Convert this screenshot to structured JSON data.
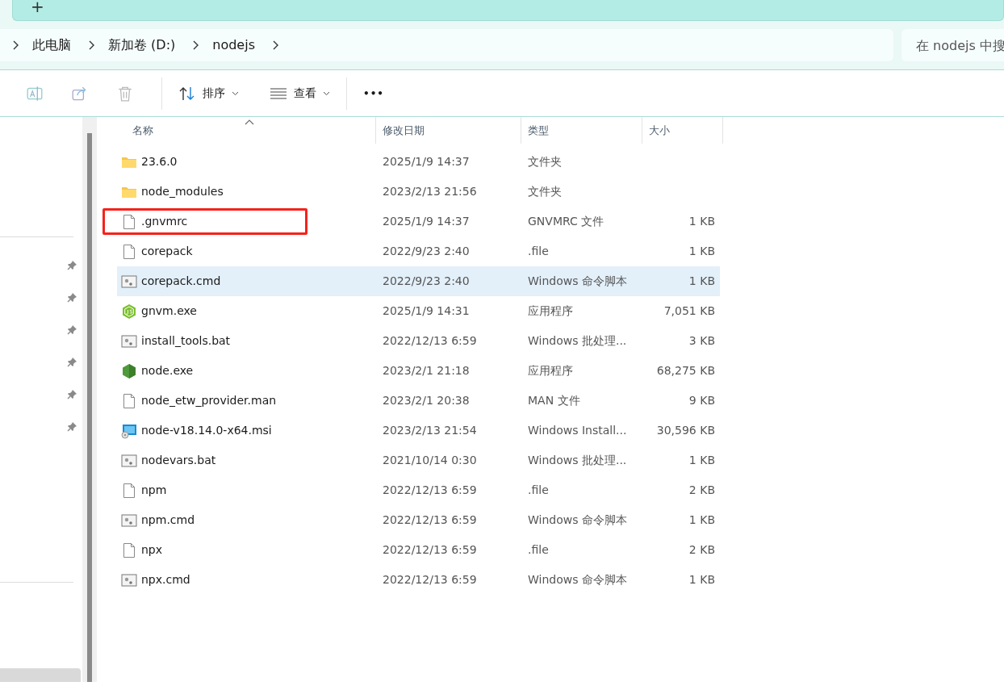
{
  "tab_strip": {
    "new_tab": "+"
  },
  "breadcrumb": {
    "items": [
      "此电脑",
      "新加卷 (D:)",
      "nodejs"
    ]
  },
  "search": {
    "placeholder": "在 nodejs 中搜"
  },
  "toolbar": {
    "sort": "排序",
    "view": "查看",
    "more": "•••"
  },
  "sidebar": {
    "pinned_count_icons": [
      {
        "kind": "pin"
      },
      {
        "kind": "pin"
      },
      {
        "kind": "pin"
      },
      {
        "kind": "pin"
      },
      {
        "kind": "pin"
      },
      {
        "kind": "pin"
      }
    ]
  },
  "table": {
    "columns": [
      "名称",
      "修改日期",
      "类型",
      "大小"
    ],
    "rows": [
      {
        "kind": "folder",
        "name": "23.6.0",
        "date": "2025/1/9 14:37",
        "type": "文件夹",
        "size": "",
        "selected": false,
        "annotated": false
      },
      {
        "kind": "folder",
        "name": "node_modules",
        "date": "2023/2/13 21:56",
        "type": "文件夹",
        "size": "",
        "selected": false,
        "annotated": false
      },
      {
        "kind": "file",
        "name": ".gnvmrc",
        "date": "2025/1/9 14:37",
        "type": "GNVMRC 文件",
        "size": "1 KB",
        "selected": false,
        "annotated": true
      },
      {
        "kind": "file",
        "name": "corepack",
        "date": "2022/9/23 2:40",
        "type": ".file",
        "size": "1 KB",
        "selected": false,
        "annotated": false
      },
      {
        "kind": "script",
        "name": "corepack.cmd",
        "date": "2022/9/23 2:40",
        "type": "Windows 命令脚本",
        "size": "1 KB",
        "selected": true,
        "annotated": false
      },
      {
        "kind": "js",
        "name": "gnvm.exe",
        "date": "2025/1/9 14:31",
        "type": "应用程序",
        "size": "7,051 KB",
        "selected": false,
        "annotated": false
      },
      {
        "kind": "script",
        "name": "install_tools.bat",
        "date": "2022/12/13 6:59",
        "type": "Windows 批处理...",
        "size": "3 KB",
        "selected": false,
        "annotated": false
      },
      {
        "kind": "node",
        "name": "node.exe",
        "date": "2023/2/1 21:18",
        "type": "应用程序",
        "size": "68,275 KB",
        "selected": false,
        "annotated": false
      },
      {
        "kind": "file",
        "name": "node_etw_provider.man",
        "date": "2023/2/1 20:38",
        "type": "MAN 文件",
        "size": "9 KB",
        "selected": false,
        "annotated": false
      },
      {
        "kind": "installer",
        "name": "node-v18.14.0-x64.msi",
        "date": "2023/2/13 21:54",
        "type": "Windows Install...",
        "size": "30,596 KB",
        "selected": false,
        "annotated": false
      },
      {
        "kind": "script",
        "name": "nodevars.bat",
        "date": "2021/10/14 0:30",
        "type": "Windows 批处理...",
        "size": "1 KB",
        "selected": false,
        "annotated": false
      },
      {
        "kind": "file",
        "name": "npm",
        "date": "2022/12/13 6:59",
        "type": ".file",
        "size": "2 KB",
        "selected": false,
        "annotated": false
      },
      {
        "kind": "script",
        "name": "npm.cmd",
        "date": "2022/12/13 6:59",
        "type": "Windows 命令脚本",
        "size": "1 KB",
        "selected": false,
        "annotated": false
      },
      {
        "kind": "file",
        "name": "npx",
        "date": "2022/12/13 6:59",
        "type": ".file",
        "size": "2 KB",
        "selected": false,
        "annotated": false
      },
      {
        "kind": "script",
        "name": "npx.cmd",
        "date": "2022/12/13 6:59",
        "type": "Windows 命令脚本",
        "size": "1 KB",
        "selected": false,
        "annotated": false
      }
    ]
  }
}
